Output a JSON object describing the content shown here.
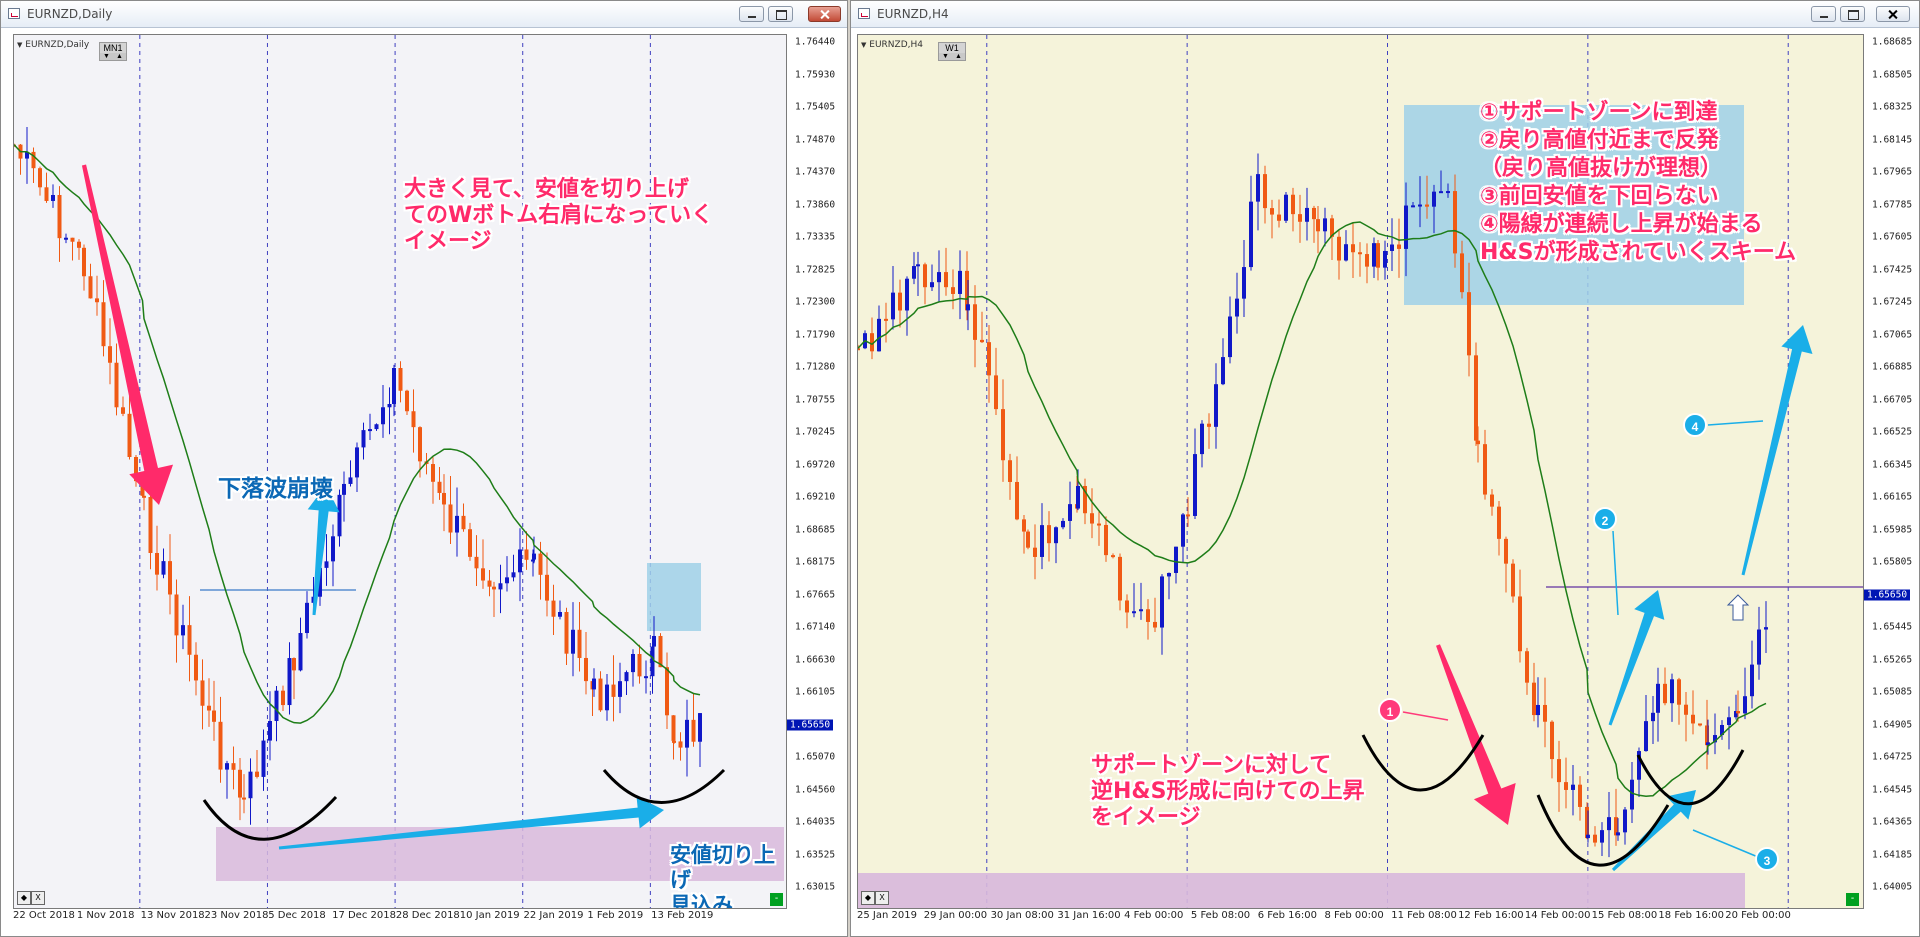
{
  "colors": {
    "bull": "#1018c8",
    "bear": "#f05a14",
    "ma": "#1e7d18",
    "pinkArrow": "#ff2a6a",
    "blueArrow": "#1aaee8",
    "supportZone": "#d8b8dc",
    "boxZone": "#9fd0e8",
    "badgePink": "#ff3a7a",
    "badgeBlue": "#1aaee8"
  },
  "win1": {
    "title": "EURNZD,Daily",
    "symbol": "EURNZD,Daily",
    "tf": "MN1",
    "current_price": "1.65650",
    "prices": [
      "1.76440",
      "1.75930",
      "1.75405",
      "1.74870",
      "1.74370",
      "1.73860",
      "1.73335",
      "1.72825",
      "1.72300",
      "1.71790",
      "1.71280",
      "1.70755",
      "1.70245",
      "1.69720",
      "1.69210",
      "1.68685",
      "1.68175",
      "1.67665",
      "1.67140",
      "1.66630",
      "1.66105",
      "1.65650",
      "1.65070",
      "1.64560",
      "1.64035",
      "1.63525",
      "1.63015"
    ],
    "dates": [
      "22 Oct 2018",
      "1 Nov 2018",
      "13 Nov 2018",
      "23 Nov 2018",
      "5 Dec 2018",
      "17 Dec 2018",
      "28 Dec 2018",
      "10 Jan 2019",
      "22 Jan 2019",
      "1 Feb 2019",
      "13 Feb 2019"
    ],
    "ann1": "大きく見て、安値を切り上げ\nてのWボトム右肩になっていく\nイメージ",
    "ann2": "下落波崩壊",
    "ann3": "安値切り上げ\n見込み",
    "x_label": "X",
    "green_label": "-"
  },
  "win2": {
    "title": "EURNZD,H4",
    "symbol": "EURNZD,H4",
    "tf": "W1",
    "current_price": "1.65650",
    "prices": [
      "1.68685",
      "1.68505",
      "1.68325",
      "1.68145",
      "1.67965",
      "1.67785",
      "1.67605",
      "1.67425",
      "1.67245",
      "1.67065",
      "1.66885",
      "1.66705",
      "1.66525",
      "1.66345",
      "1.66165",
      "1.65985",
      "1.65805",
      "1.65650",
      "1.65445",
      "1.65265",
      "1.65085",
      "1.64905",
      "1.64725",
      "1.64545",
      "1.64365",
      "1.64185",
      "1.64005"
    ],
    "dates": [
      "25 Jan 2019",
      "29 Jan 00:00",
      "30 Jan 08:00",
      "31 Jan 16:00",
      "4 Feb 00:00",
      "5 Feb 08:00",
      "6 Feb 16:00",
      "8 Feb 00:00",
      "11 Feb 08:00",
      "12 Feb 16:00",
      "14 Feb 00:00",
      "15 Feb 08:00",
      "18 Feb 16:00",
      "20 Feb 00:00"
    ],
    "ann_list": "①サポートゾーンに到達\n②戻り高値付近まで反発\n（戻り高値抜けが理想）\n③前回安値を下回らない\n④陽線が連続し上昇が始まる\nH&Sが形成されていくスキーム",
    "ann_bottom": "サポートゾーンに対して\n逆H&S形成に向けての上昇\nをイメージ",
    "badges": [
      "1",
      "2",
      "3",
      "4"
    ],
    "x_label": "X",
    "green_label": "-"
  }
}
